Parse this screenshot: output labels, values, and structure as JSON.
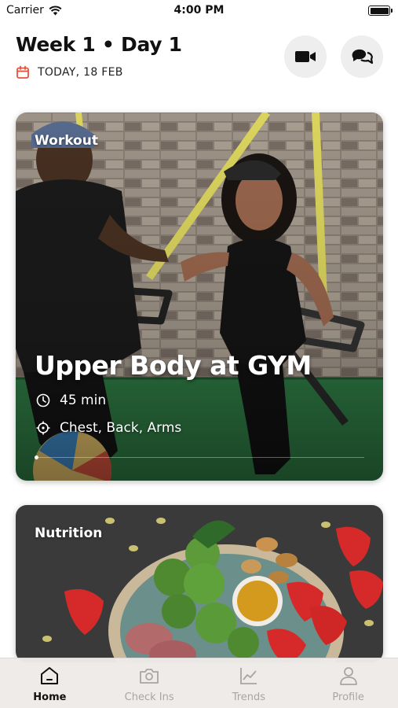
{
  "status_bar": {
    "carrier": "Carrier",
    "time": "4:00 PM"
  },
  "header": {
    "title": "Week 1 • Day 1",
    "date": "TODAY, 18 FEB"
  },
  "workout_card": {
    "tag": "Workout",
    "title": "Upper Body at GYM",
    "duration": "45 min",
    "muscles": "Chest, Back, Arms"
  },
  "nutrition_card": {
    "tag": "Nutrition"
  },
  "tab_bar": {
    "items": [
      {
        "label": "Home",
        "icon": "home-icon",
        "active": true
      },
      {
        "label": "Check Ins",
        "icon": "camera-icon",
        "active": false
      },
      {
        "label": "Trends",
        "icon": "chart-icon",
        "active": false
      },
      {
        "label": "Profile",
        "icon": "person-icon",
        "active": false
      }
    ]
  },
  "colors": {
    "accent": "#e4533f",
    "tab_active": "#111111",
    "tab_inactive": "#a6a6a6",
    "round_button_bg": "#eeeeee"
  }
}
